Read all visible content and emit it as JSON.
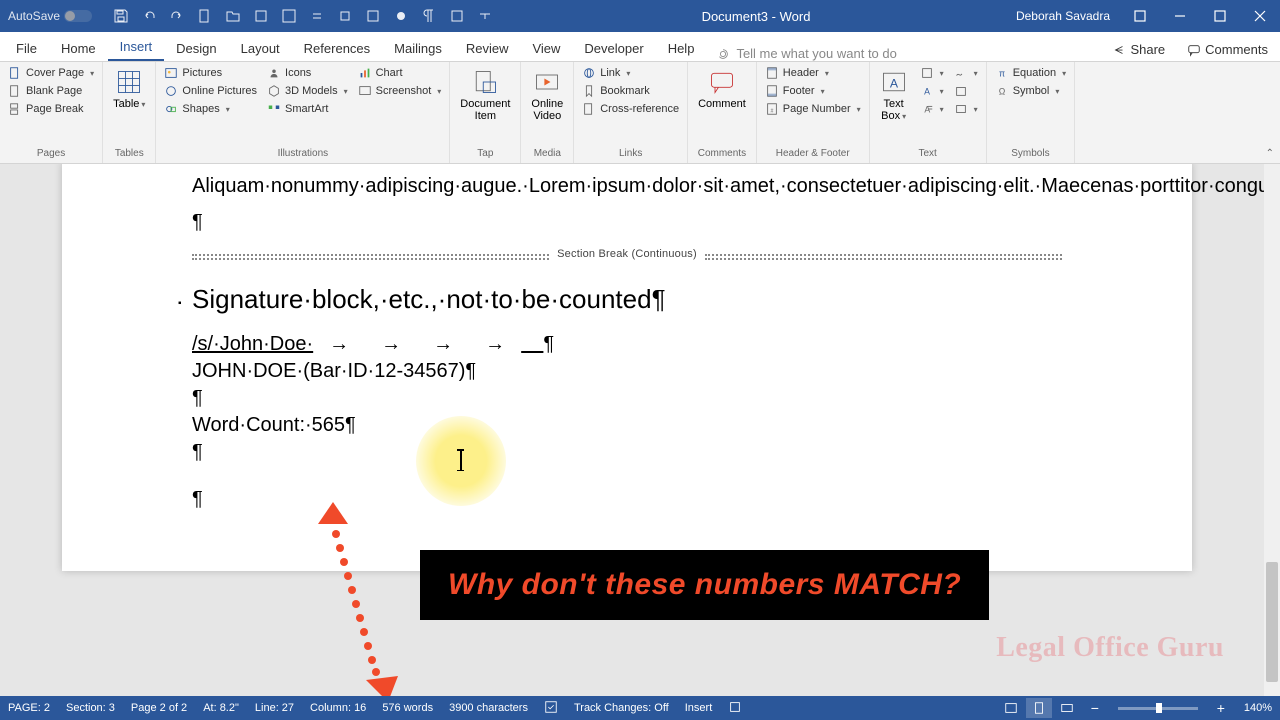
{
  "title_bar": {
    "autosave_label": "AutoSave",
    "document_title": "Document3 - Word",
    "user_name": "Deborah Savadra"
  },
  "tabs": {
    "file": "File",
    "home": "Home",
    "insert": "Insert",
    "design": "Design",
    "layout": "Layout",
    "references": "References",
    "mailings": "Mailings",
    "review": "Review",
    "view": "View",
    "developer": "Developer",
    "help": "Help",
    "tell_me": "Tell me what you want to do",
    "share": "Share",
    "comments": "Comments"
  },
  "ribbon": {
    "pages": {
      "cover_page": "Cover Page",
      "blank_page": "Blank Page",
      "page_break": "Page Break",
      "label": "Pages"
    },
    "tables": {
      "table": "Table",
      "label": "Tables"
    },
    "illustrations": {
      "pictures": "Pictures",
      "online_pictures": "Online Pictures",
      "shapes": "Shapes",
      "icons": "Icons",
      "models": "3D Models",
      "smartart": "SmartArt",
      "chart": "Chart",
      "screenshot": "Screenshot",
      "label": "Illustrations"
    },
    "tap": {
      "document_item": "Document\nItem",
      "label": "Tap"
    },
    "media": {
      "online_video": "Online\nVideo",
      "label": "Media"
    },
    "links": {
      "link": "Link",
      "bookmark": "Bookmark",
      "cross_reference": "Cross-reference",
      "label": "Links"
    },
    "comments": {
      "comment": "Comment",
      "label": "Comments"
    },
    "header_footer": {
      "header": "Header",
      "footer": "Footer",
      "page_number": "Page Number",
      "label": "Header & Footer"
    },
    "text": {
      "text_box": "Text\nBox",
      "label": "Text"
    },
    "symbols": {
      "equation": "Equation",
      "symbol": "Symbol",
      "label": "Symbols"
    }
  },
  "document": {
    "body_text": "Aliquam·nonummy·adipiscing·augue.·Lorem·ipsum·dolor·sit·amet,·consectetuer·adipiscing·elit.·Maecenas·porttitor·congue·massa.·Fusce·posuere,·magna·sed·pulvinar·ultricies,·purus·lectus·malesuada·libero,·sit·amet·commodo·magna·eros·quis·urna.·Nunc·viverra·imperdiet·enim.¶",
    "section_break": "Section Break (Continuous)",
    "heading": "Signature·block,·etc.,·not·to·be·counted¶",
    "sig_line": "/s/·John·Doe",
    "sig_name": "JOHN·DOE·(Bar·ID·12-34567)¶",
    "word_count_line": "Word·Count:·565¶"
  },
  "annotation": {
    "text": "Why don't these numbers MATCH?",
    "watermark": "Legal Office Guru"
  },
  "status_bar": {
    "page": "PAGE: 2",
    "section": "Section: 3",
    "page_of": "Page 2 of 2",
    "at": "At: 8.2\"",
    "line": "Line: 27",
    "column": "Column: 16",
    "words": "576 words",
    "characters": "3900 characters",
    "track_changes": "Track Changes: Off",
    "insert": "Insert",
    "zoom": "140%"
  }
}
